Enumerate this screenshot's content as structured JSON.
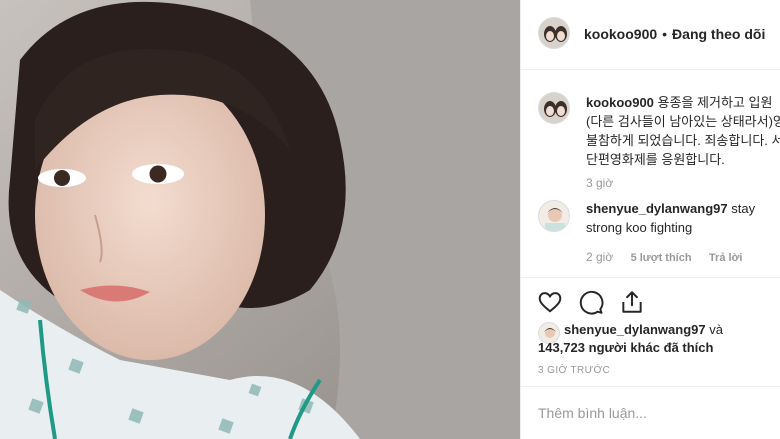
{
  "post": {
    "username": "kookoo900",
    "follow_status": "Đang theo dõi",
    "caption": {
      "username": "kookoo900",
      "lines": [
        "용종을 제거하고 입원",
        "(다른 검사들이 남아있는 상태라서)영",
        "불참하게 되었습니다. 죄송합니다. 서",
        "단편영화제를 응원합니다."
      ],
      "time": "3 giờ"
    },
    "comments": [
      {
        "username": "shenyue_dylanwang97",
        "text_line1": "stay",
        "text_line2": "strong koo fighting",
        "time": "2 giờ",
        "likes": "5 lượt thích",
        "reply": "Trả lời"
      }
    ],
    "likes": {
      "first_user": "shenyue_dylanwang97",
      "connector": "và",
      "count": "143,723",
      "suffix": "người khác đã thích"
    },
    "timestamp": "3 GIỜ TRƯỚC",
    "add_comment_placeholder": "Thêm bình luận..."
  },
  "icons": [
    "heart-icon",
    "comment-icon",
    "share-icon"
  ]
}
